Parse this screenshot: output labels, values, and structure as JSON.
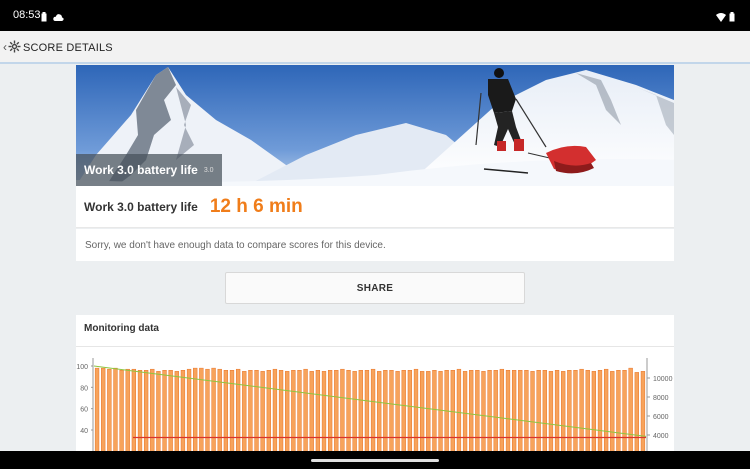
{
  "status_bar": {
    "time": "08:53"
  },
  "app_bar": {
    "title": "SCORE DETAILS"
  },
  "hero": {
    "title": "Work 3.0 battery life",
    "version": "3.0"
  },
  "result": {
    "label": "Work 3.0 battery life",
    "value": "12 h 6 min"
  },
  "note": "Sorry, we don't have enough data to compare scores for this device.",
  "share_label": "SHARE",
  "monitoring": {
    "title": "Monitoring data"
  },
  "colors": {
    "accent": "#f07d1a",
    "bar": "#f7a35b",
    "bar_outline": "#e8742a",
    "line_green": "#8dc63f",
    "line_red": "#d9342b"
  },
  "chart_data": {
    "type": "bar",
    "y_left_ticks": [
      "100",
      "80",
      "60",
      "40"
    ],
    "y_right_ticks": [
      "10000",
      "8000",
      "6000",
      "4000"
    ],
    "bar_count": 90,
    "values": [
      98,
      98,
      97,
      98,
      96,
      97,
      97,
      96,
      96,
      97,
      95,
      96,
      96,
      95,
      96,
      97,
      98,
      98,
      97,
      98,
      97,
      96,
      96,
      97,
      95,
      96,
      96,
      95,
      96,
      97,
      96,
      95,
      96,
      96,
      97,
      95,
      96,
      95,
      96,
      96,
      97,
      96,
      95,
      96,
      96,
      97,
      95,
      96,
      96,
      95,
      96,
      96,
      97,
      95,
      95,
      96,
      95,
      96,
      96,
      97,
      95,
      96,
      96,
      95,
      96,
      96,
      97,
      96,
      96,
      96,
      96,
      95,
      96,
      96,
      95,
      96,
      95,
      96,
      96,
      97,
      96,
      95,
      96,
      97,
      95,
      96,
      96,
      98,
      94,
      95
    ],
    "green_line": {
      "start": 100,
      "end": 34
    },
    "red_line": {
      "level": 33
    }
  }
}
